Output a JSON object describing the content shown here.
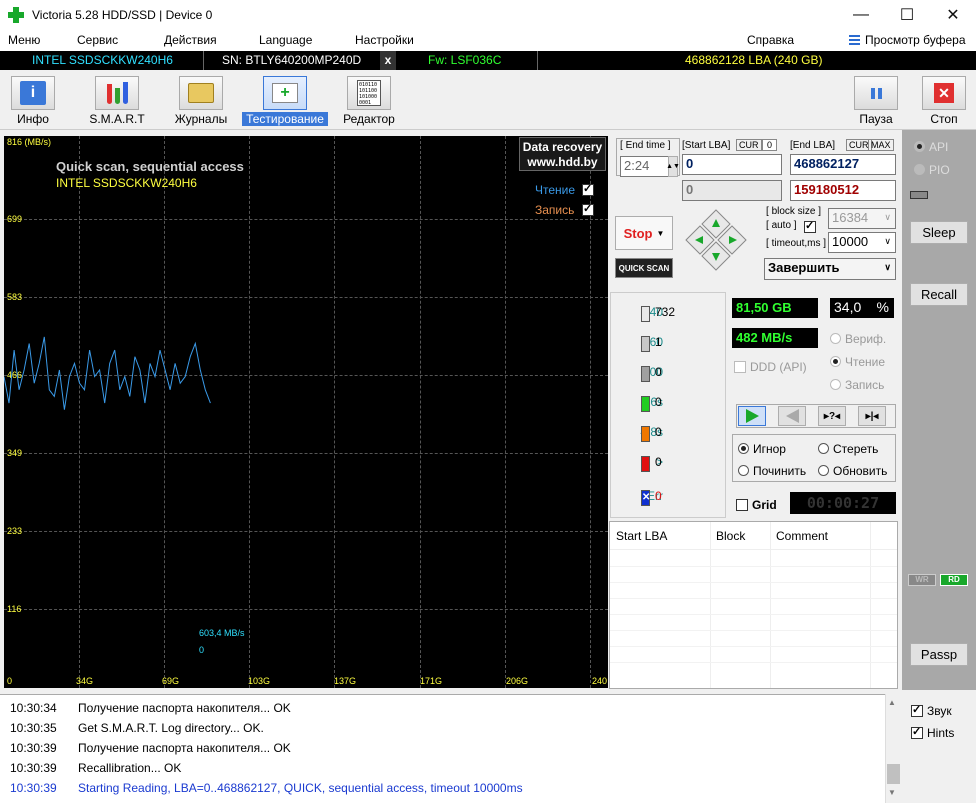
{
  "window": {
    "title": "Victoria 5.28 HDD/SSD | Device 0",
    "minimize": "—",
    "maximize": "☐",
    "close": "✕"
  },
  "menu": {
    "items": [
      "Меню",
      "Сервис",
      "Действия",
      "Language",
      "Настройки",
      "Справка"
    ],
    "clipboard": "Просмотр буфера"
  },
  "device": {
    "model": "INTEL SSDSCKKW240H6",
    "serial": "SN: BTLY640200MP240D",
    "close": "x",
    "firmware": "Fw: LSF036C",
    "capacity": "468862128 LBA (240 GB)"
  },
  "toolbar": {
    "info": "Инфо",
    "smart": "S.M.A.R.T",
    "logs": "Журналы",
    "test": "Тестирование",
    "editor": "Редактор",
    "pause": "Пауза",
    "stop": "Стоп"
  },
  "graph": {
    "title": "Quick scan, sequential access",
    "model": "INTEL SSDSCKKW240H6",
    "yunit": "816 (MB/s)",
    "yticks": [
      "699",
      "583",
      "466",
      "349",
      "233",
      "116"
    ],
    "xticks": [
      "0",
      "34G",
      "69G",
      "103G",
      "137G",
      "171G",
      "206G",
      "240"
    ],
    "read_label": "Чтение",
    "write_label": "Запись",
    "recovery_line1": "Data recovery",
    "recovery_line2": "www.hdd.by",
    "speed_readout": "603,4 MB/s",
    "zero_readout": "0",
    "colors": {
      "line": "#3a9ae8",
      "axis_text": "#ffff40",
      "title": "#d0d0d0",
      "model": "#ffff40"
    }
  },
  "chart_data": {
    "type": "line",
    "ylim": [
      0,
      816
    ],
    "xlim": [
      0,
      240
    ],
    "series": [
      {
        "x": [
          0,
          2,
          4,
          6,
          8,
          10,
          12,
          14,
          16,
          18,
          20,
          22,
          24,
          26,
          28,
          30,
          32,
          34,
          36,
          38,
          40,
          42,
          44,
          46,
          48,
          50,
          52,
          54,
          56,
          58,
          60,
          62,
          64,
          66,
          68,
          70,
          72,
          74,
          76,
          78,
          80,
          82
        ],
        "y": [
          460,
          420,
          500,
          440,
          470,
          510,
          450,
          480,
          520,
          440,
          430,
          470,
          410,
          460,
          480,
          450,
          440,
          500,
          460,
          470,
          420,
          480,
          500,
          440,
          460,
          430,
          490,
          470,
          420,
          480,
          460,
          500,
          470,
          440,
          480,
          450,
          460,
          490,
          510,
          470,
          440,
          420
        ]
      }
    ]
  },
  "controls": {
    "end_time_label": "End time",
    "end_time": "2:24",
    "start_lba_label": "Start LBA",
    "cur_label": "CUR",
    "cur_value": "0",
    "start_lba": "0",
    "start_lba2": "0",
    "end_lba_label": "End LBA",
    "end_cur": "CUR",
    "end_max": "MAX",
    "end_lba": "468862127",
    "end_lba2": "159180512",
    "stop_btn": "Stop",
    "quick_scan": "QUICK SCAN",
    "block_size_label": "block size",
    "auto_label": "auto",
    "block_size": "16384",
    "timeout_label": "timeout,ms",
    "timeout": "10000",
    "finish": "Завершить"
  },
  "stats": {
    "rows": [
      {
        "label": "40",
        "value": "732",
        "color": "#e8e8e8"
      },
      {
        "label": "160",
        "value": "1",
        "color": "#c8c8c8"
      },
      {
        "label": "400",
        "value": "0",
        "color": "#a0a0a0"
      },
      {
        "label": "1,6s",
        "value": "0",
        "color": "#20cc20"
      },
      {
        "label": "4,8s",
        "value": "0",
        "color": "#f07800"
      },
      {
        "label": ">",
        "value": "0",
        "color": "#e01010"
      }
    ],
    "err_label": "Err",
    "err_value": "0",
    "processed": "81,50 GB",
    "percent": "34,0",
    "percent_sign": "%",
    "speed": "482 MB/s",
    "ddd": "DDD (API)",
    "verify": "Вериф.",
    "read": "Чтение",
    "write": "Запись",
    "ignore": "Игнор",
    "erase": "Стереть",
    "repair": "Починить",
    "refresh": "Обновить",
    "grid": "Grid",
    "timer": "00:00:27"
  },
  "table": {
    "headers": [
      "Start LBA",
      "Block",
      "Comment"
    ]
  },
  "side": {
    "api": "API",
    "pio": "PIO",
    "sleep": "Sleep",
    "recall": "Recall",
    "wr": "WR",
    "rd": "RD",
    "passp": "Passp",
    "sound": "Звук",
    "hints": "Hints"
  },
  "log": [
    {
      "time": "10:30:34",
      "text": "Получение паспорта накопителя... OK"
    },
    {
      "time": "10:30:35",
      "text": "Get S.M.A.R.T. Log directory... OK."
    },
    {
      "time": "10:30:39",
      "text": "Получение паспорта накопителя... OK"
    },
    {
      "time": "10:30:39",
      "text": "Recallibration... OK"
    },
    {
      "time": "10:30:39",
      "text": "Starting Reading, LBA=0..468862127, QUICK, sequential access, timeout 10000ms"
    }
  ]
}
